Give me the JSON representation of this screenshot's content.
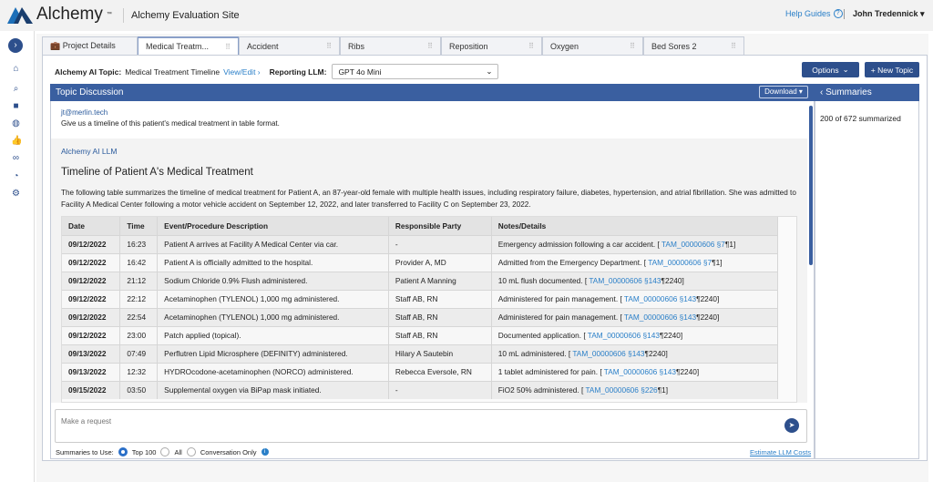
{
  "header": {
    "logo": "Alchemy",
    "site_title": "Alchemy Evaluation Site",
    "help": "Help Guides",
    "user": "John Tredennick"
  },
  "sidebar": {
    "icons": [
      "chevron-right-icon",
      "home-icon",
      "search-icon",
      "folder-icon",
      "brain-icon",
      "thumbs-up-icon",
      "link-icon",
      "pie-chart-icon",
      "gear-icon"
    ]
  },
  "tabs": [
    {
      "label": "Project Details"
    },
    {
      "label": "Medical Treatm..."
    },
    {
      "label": "Accident"
    },
    {
      "label": "Ribs"
    },
    {
      "label": "Reposition"
    },
    {
      "label": "Oxygen"
    },
    {
      "label": "Bed Sores 2"
    }
  ],
  "topic": {
    "label": "Alchemy AI Topic:",
    "value": "Medical Treatment Timeline",
    "edit": "View/Edit",
    "llm_label": "Reporting LLM:",
    "llm_value": "GPT 4o Mini"
  },
  "actions": {
    "options": "Options",
    "new_topic": "+ New Topic"
  },
  "discussion": {
    "title": "Topic Discussion",
    "download": "Download",
    "user_email": "jt@merlin.tech",
    "user_msg": "Give us a timeline of this patient's medical treatment in table format.",
    "ai_label": "Alchemy AI LLM",
    "ai_title": "Timeline of Patient A's Medical Treatment",
    "ai_para": "The following table summarizes the timeline of medical treatment for Patient A, an 87-year-old female with multiple health issues, including respiratory failure, diabetes, hypertension, and atrial fibrillation. She was admitted to Facility A Medical Center following a motor vehicle accident on September 12, 2022, and later transferred to Facility C on September 23, 2022."
  },
  "table": {
    "headers": [
      "Date",
      "Time",
      "Event/Procedure Description",
      "Responsible Party",
      "Notes/Details"
    ],
    "rows": [
      [
        "09/12/2022",
        "16:23",
        "Patient A arrives at Facility A Medical Center via car.",
        "-",
        "Emergency admission following a car accident. [ ",
        "TAM_00000606 §7",
        "¶1]"
      ],
      [
        "09/12/2022",
        "16:42",
        "Patient A is officially admitted to the hospital.",
        "Provider A, MD",
        "Admitted from the Emergency Department. [ ",
        "TAM_00000606 §7",
        "¶1]"
      ],
      [
        "09/12/2022",
        "21:12",
        "Sodium Chloride 0.9% Flush administered.",
        "Patient A Manning",
        "10 mL flush documented. [ ",
        "TAM_00000606 §143",
        "¶2240]"
      ],
      [
        "09/12/2022",
        "22:12",
        "Acetaminophen (TYLENOL) 1,000 mg administered.",
        "Staff AB, RN",
        "Administered for pain management. [ ",
        "TAM_00000606 §143",
        "¶2240]"
      ],
      [
        "09/12/2022",
        "22:54",
        "Acetaminophen (TYLENOL) 1,000 mg administered.",
        "Staff AB, RN",
        "Administered for pain management. [ ",
        "TAM_00000606 §143",
        "¶2240]"
      ],
      [
        "09/12/2022",
        "23:00",
        "Patch applied (topical).",
        "Staff AB, RN",
        "Documented application. [ ",
        "TAM_00000606 §143",
        "¶2240]"
      ],
      [
        "09/13/2022",
        "07:49",
        "Perflutren Lipid Microsphere (DEFINITY) administered.",
        "Hilary A Sautebin",
        "10 mL administered. [ ",
        "TAM_00000606 §143",
        "¶2240]"
      ],
      [
        "09/13/2022",
        "12:32",
        "HYDROcodone-acetaminophen (NORCO) administered.",
        "Rebecca Eversole, RN",
        "1 tablet administered for pain. [ ",
        "TAM_00000606 §143",
        "¶2240]"
      ],
      [
        "09/15/2022",
        "03:50",
        "Supplemental oxygen via BiPap mask initiated.",
        "-",
        "FiO2 50% administered. [ ",
        "TAM_00000606 §226",
        "¶1]"
      ]
    ]
  },
  "request": {
    "placeholder": "Make a request"
  },
  "summaries_use": {
    "label": "Summaries to Use:",
    "options": [
      "Top 100",
      "All",
      "Conversation Only"
    ],
    "selected": "Top 100",
    "estimate": "Estimate LLM Costs"
  },
  "summaries": {
    "title": "Summaries",
    "count": "200 of 672 summarized"
  }
}
